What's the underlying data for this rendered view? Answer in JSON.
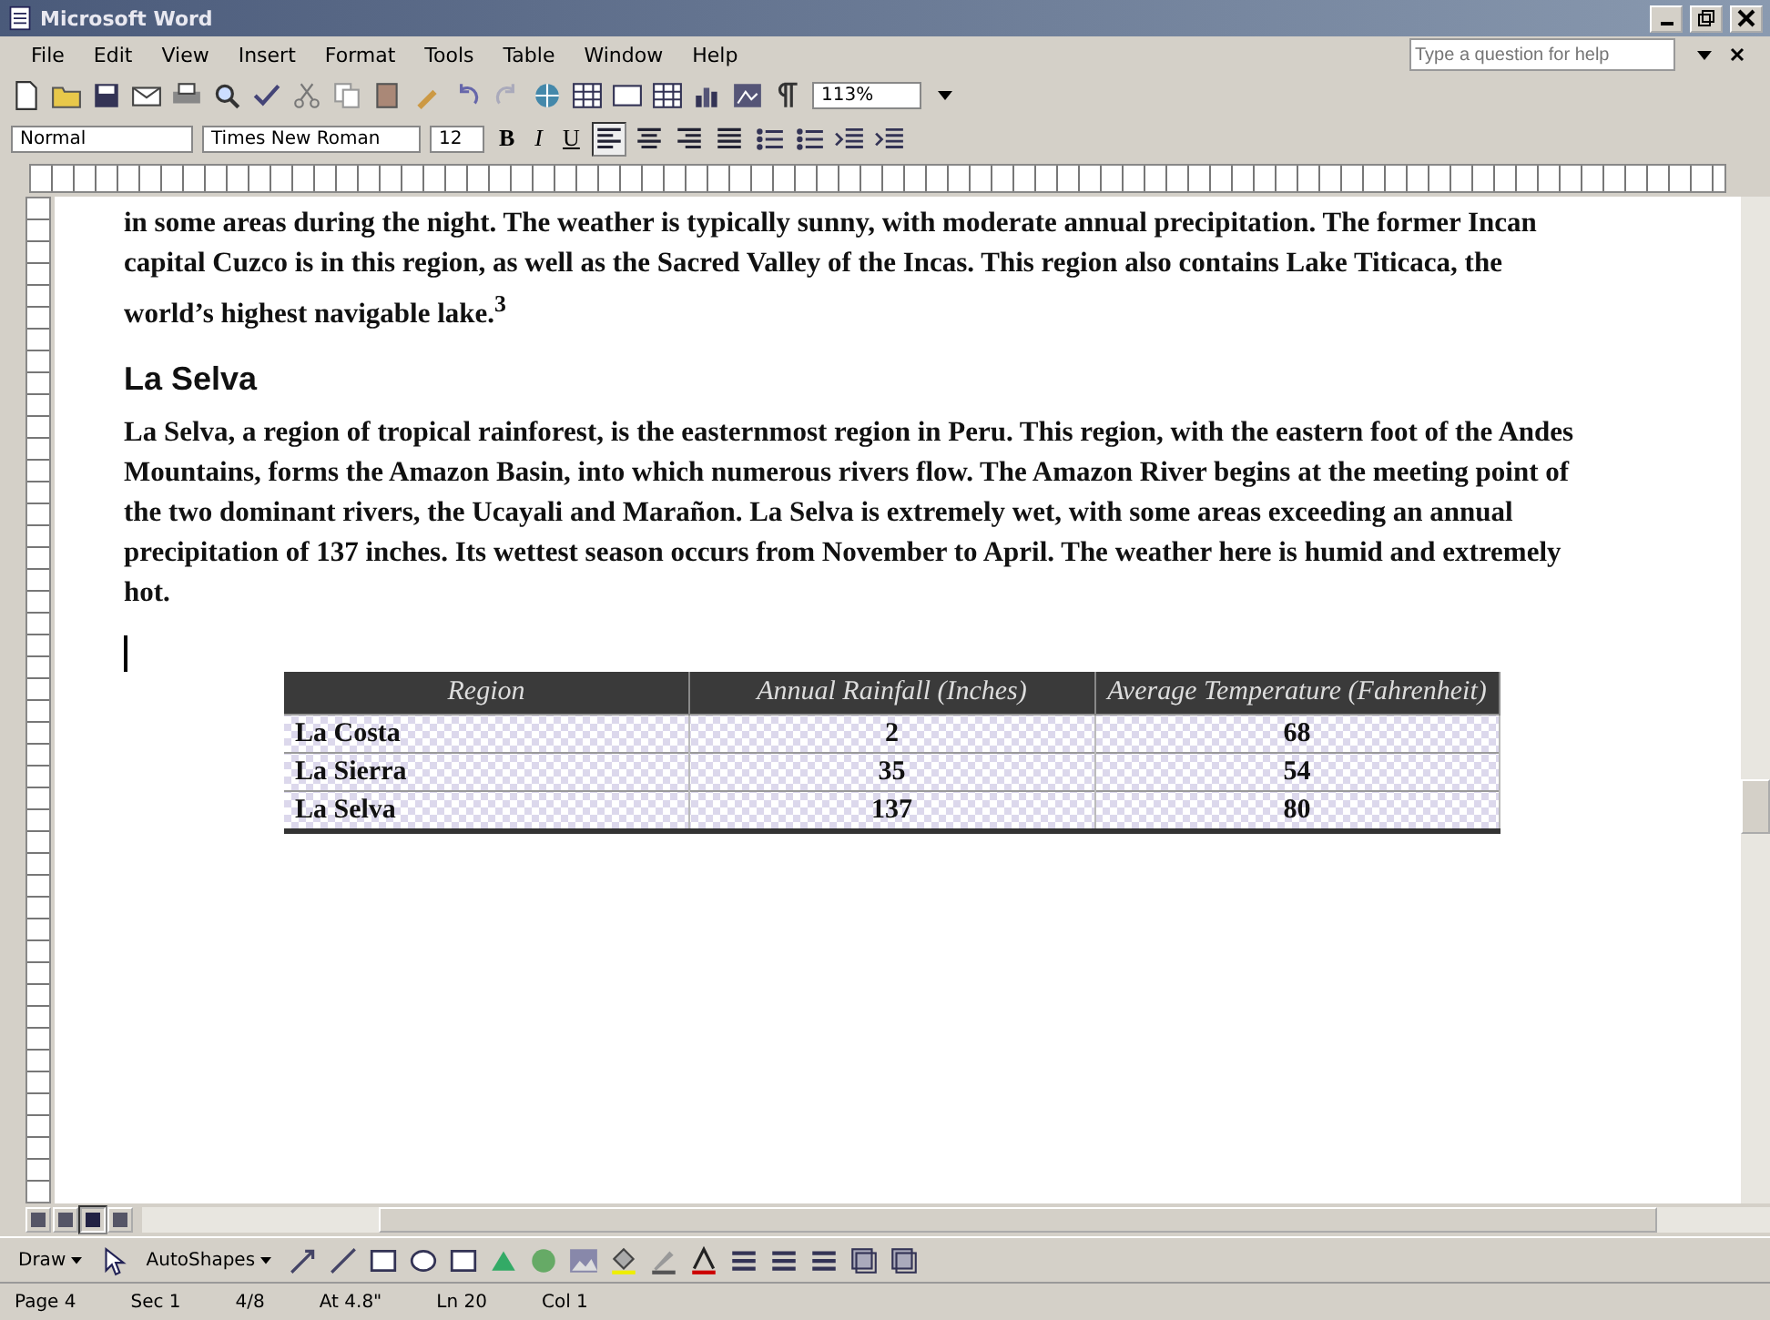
{
  "window": {
    "title": "Microsoft Word"
  },
  "menu": [
    "File",
    "Edit",
    "View",
    "Insert",
    "Format",
    "Tools",
    "Table",
    "Window",
    "Help"
  ],
  "help_box": {
    "placeholder": "Type a question for help"
  },
  "standard_toolbar": {
    "zoom": "113%"
  },
  "formatting_toolbar": {
    "style": "Normal",
    "font": "Times New Roman",
    "size": "12",
    "text_buttons": [
      {
        "label": "B",
        "kind": "bold"
      },
      {
        "label": "I",
        "kind": "italic"
      },
      {
        "label": "U",
        "kind": "underline"
      }
    ],
    "align": [
      {
        "selected": true
      },
      {
        "selected": false
      },
      {
        "selected": false
      },
      {
        "selected": false
      }
    ]
  },
  "document": {
    "blocks": [
      {
        "kind": "paragraph",
        "text": "in some areas during the night. The weather is typically sunny, with moderate annual precipitation. The former Incan capital Cuzco is in this region, as well as the Sacred Valley of the Incas. This region also contains Lake Titicaca, the world’s highest navigable lake.$^{3}$"
      },
      {
        "kind": "heading",
        "text": "La Selva"
      },
      {
        "kind": "paragraph",
        "text": "La Selva, a region of tropical rainforest, is the easternmost region in Peru. This region, with the eastern foot of the Andes Mountains, forms the Amazon Basin, into which numerous rivers flow. The Amazon River begins at the meeting point of the two dominant rivers, the Ucayali and Marañon. La Selva is extremely wet, with some areas exceeding an annual precipitation of 137 inches. Its wettest season occurs from November to April.  The weather here is humid and extremely hot."
      }
    ],
    "table": {
      "columns": [
        "Region",
        "Annual Rainfall (Inches)",
        "Average Temperature (Fahrenheit)"
      ],
      "rows": [
        [
          "La Costa",
          "2",
          "68"
        ],
        [
          "La Sierra",
          "35",
          "54"
        ],
        [
          "La Selva",
          "137",
          "80"
        ]
      ]
    }
  },
  "view_buttons": [
    {
      "selected": false
    },
    {
      "selected": false
    },
    {
      "selected": true
    },
    {
      "selected": false
    }
  ],
  "drawing_toolbar": {
    "draw": "Draw",
    "autoshapes": "AutoShapes"
  },
  "status_bar": [
    "Page 4",
    "Sec 1",
    "4/8",
    "At 4.8\"",
    "Ln 20",
    "Col 1"
  ]
}
